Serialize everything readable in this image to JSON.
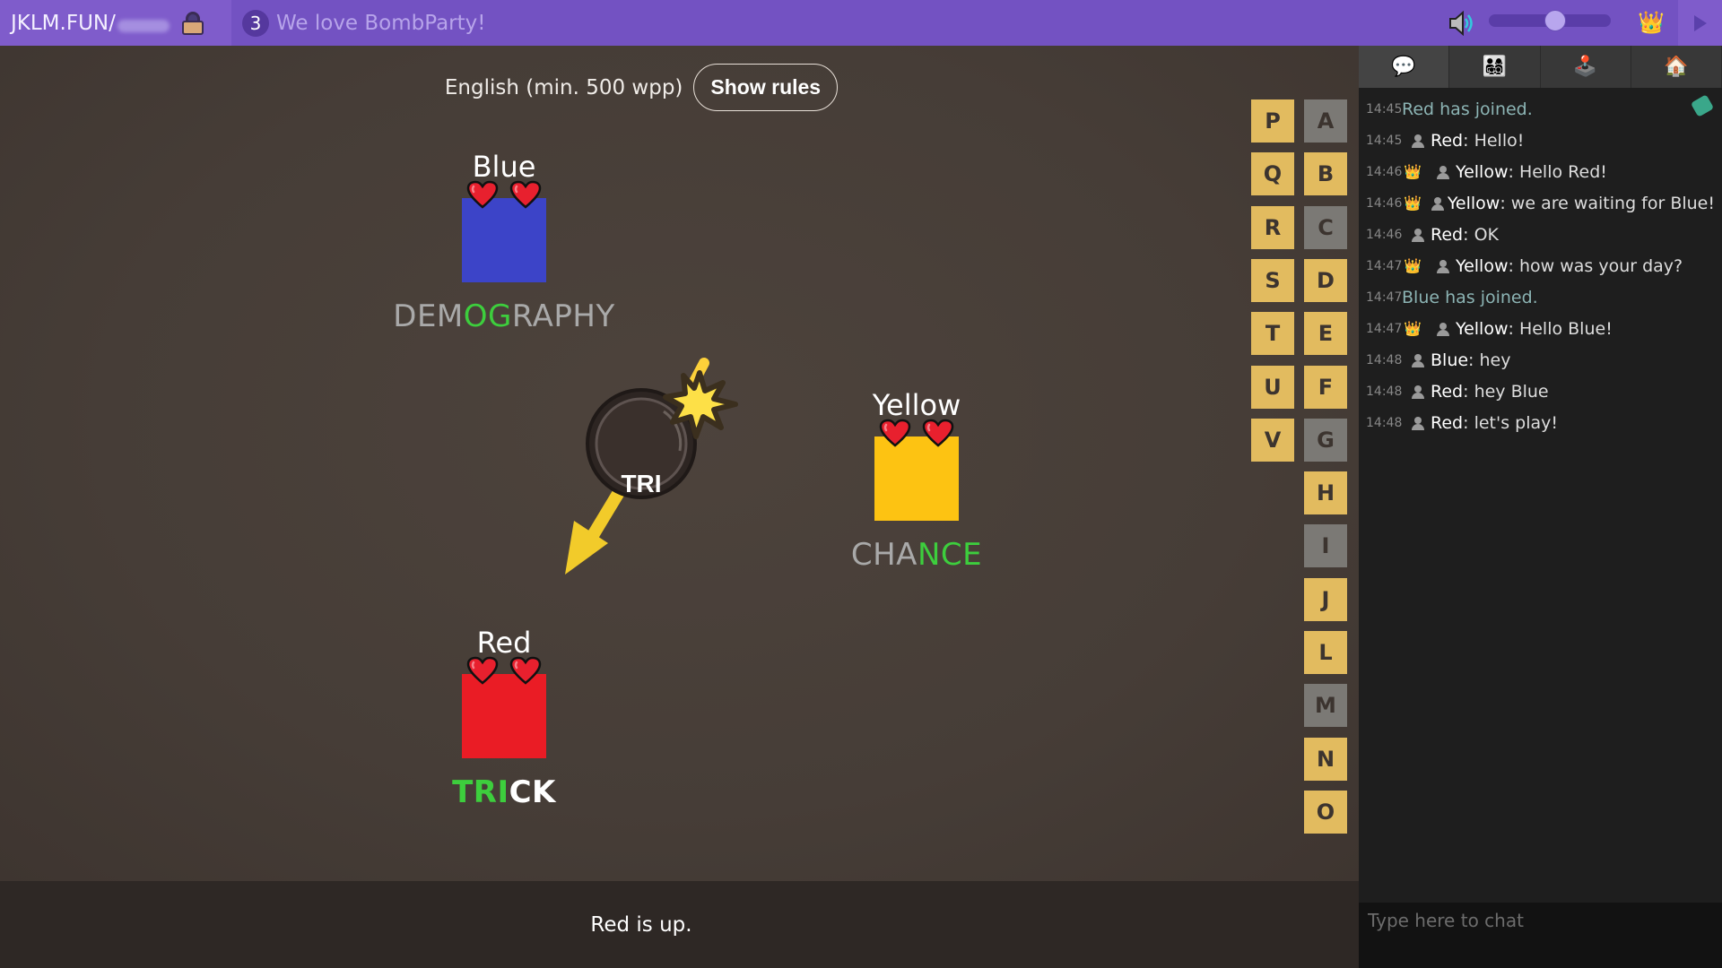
{
  "topbar": {
    "site": "JKLM.FUN/",
    "room_code_hidden": "",
    "player_count": "3",
    "room_name": "We love BombParty!",
    "volume_percent": 55,
    "icons": {
      "lock": "lock-icon",
      "volume": "speaker-icon",
      "crown": "👑",
      "toggle": "play-triangle-icon"
    }
  },
  "game": {
    "dictionary": "English (min. 500 wpp)",
    "show_rules_label": "Show rules",
    "syllable": "TRI",
    "turn_text": "Red is up.",
    "players": [
      {
        "name": "Blue",
        "color": "#3c44c8",
        "lives": 2,
        "word_segments": [
          {
            "text": "DEM",
            "match": false
          },
          {
            "text": "OG",
            "match": true
          },
          {
            "text": "RAPHY",
            "match": false
          }
        ],
        "current": false
      },
      {
        "name": "Yellow",
        "color": "#fdc312",
        "lives": 2,
        "word_segments": [
          {
            "text": "CHA",
            "match": false
          },
          {
            "text": "NCE",
            "match": true
          }
        ],
        "current": false
      },
      {
        "name": "Red",
        "color": "#ea1c25",
        "lives": 2,
        "word_segments": [
          {
            "text": "TRI",
            "match": true
          },
          {
            "text": "CK",
            "match": false
          }
        ],
        "current": true
      }
    ],
    "bonus_letters": [
      {
        "letter": "P",
        "used": true
      },
      {
        "letter": "Q",
        "used": true
      },
      {
        "letter": "R",
        "used": true
      },
      {
        "letter": "S",
        "used": true
      },
      {
        "letter": "T",
        "used": true
      },
      {
        "letter": "U",
        "used": true
      },
      {
        "letter": "V",
        "used": true
      },
      {
        "letter": "A",
        "used": false
      },
      {
        "letter": "B",
        "used": true
      },
      {
        "letter": "C",
        "used": false
      },
      {
        "letter": "D",
        "used": true
      },
      {
        "letter": "E",
        "used": true
      },
      {
        "letter": "F",
        "used": true
      },
      {
        "letter": "G",
        "used": false
      },
      {
        "letter": "H",
        "used": true
      },
      {
        "letter": "I",
        "used": false
      },
      {
        "letter": "J",
        "used": true
      },
      {
        "letter": "L",
        "used": true
      },
      {
        "letter": "M",
        "used": false
      },
      {
        "letter": "N",
        "used": true
      },
      {
        "letter": "O",
        "used": true
      }
    ]
  },
  "sidebar": {
    "tabs": [
      {
        "name": "chat",
        "icon": "💬",
        "active": true
      },
      {
        "name": "players",
        "icon": "👨‍👩‍👧‍👦",
        "active": false
      },
      {
        "name": "game",
        "icon": "🕹️",
        "active": false
      },
      {
        "name": "home",
        "icon": "🏠",
        "active": false
      }
    ],
    "messages": [
      {
        "time": "14:45",
        "system": true,
        "text": "Red has joined."
      },
      {
        "time": "14:45",
        "crown": false,
        "author": "Red",
        "text": "Hello!"
      },
      {
        "time": "14:46",
        "crown": true,
        "author": "Yellow",
        "text": "Hello Red!"
      },
      {
        "time": "14:46",
        "crown": true,
        "author": "Yellow",
        "text": "we are waiting for Blue!"
      },
      {
        "time": "14:46",
        "crown": false,
        "author": "Red",
        "text": "OK"
      },
      {
        "time": "14:47",
        "crown": true,
        "author": "Yellow",
        "text": "how was your day?"
      },
      {
        "time": "14:47",
        "system": true,
        "text": "Blue has joined."
      },
      {
        "time": "14:47",
        "crown": true,
        "author": "Yellow",
        "text": "Hello Blue!"
      },
      {
        "time": "14:48",
        "crown": false,
        "author": "Blue",
        "text": "hey"
      },
      {
        "time": "14:48",
        "crown": false,
        "author": "Red",
        "text": "hey Blue"
      },
      {
        "time": "14:48",
        "crown": false,
        "author": "Red",
        "text": "let's play!"
      }
    ],
    "chat_placeholder": "Type here to chat",
    "chat_value": ""
  }
}
